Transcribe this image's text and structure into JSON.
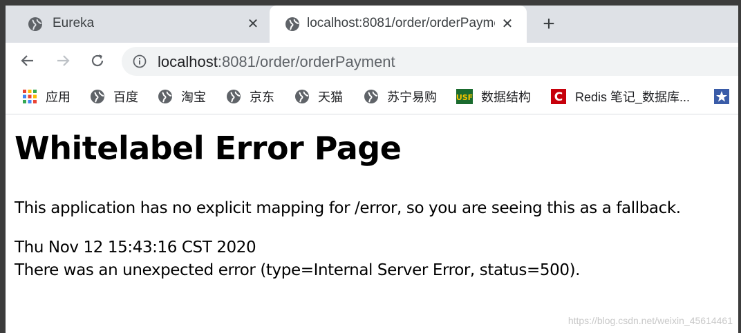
{
  "tabs": [
    {
      "title": "Eureka",
      "active": false
    },
    {
      "title": "localhost:8081/order/orderPayment",
      "active": true
    }
  ],
  "new_tab_label": "+",
  "close_glyph": "✕",
  "address_bar": {
    "host": "localhost",
    "rest": ":8081/order/orderPayment"
  },
  "bookmarks": [
    {
      "label": "应用",
      "icon": "apps-grid-icon"
    },
    {
      "label": "百度",
      "icon": "globe-icon"
    },
    {
      "label": "淘宝",
      "icon": "globe-icon"
    },
    {
      "label": "京东",
      "icon": "globe-icon"
    },
    {
      "label": "天猫",
      "icon": "globe-icon"
    },
    {
      "label": "苏宁易购",
      "icon": "globe-icon"
    },
    {
      "label": "数据结构",
      "icon": "usf-logo-icon"
    },
    {
      "label": "Redis 笔记_数据库...",
      "icon": "csdn-c-icon"
    }
  ],
  "page": {
    "heading": "Whitelabel Error Page",
    "message": "This application has no explicit mapping for /error, so you are seeing this as a fallback.",
    "timestamp": "Thu Nov 12 15:43:16 CST 2020",
    "error_detail": "There was an unexpected error (type=Internal Server Error, status=500)."
  },
  "watermark": "https://blog.csdn.net/weixin_45614461",
  "colors": {
    "tabstrip": "#dee1e6",
    "omnibox": "#f1f3f4",
    "icon": "#5f6368",
    "csdn_red": "#c7000b",
    "usf_green": "#1a6b2e",
    "usf_yellow": "#f5c400"
  }
}
